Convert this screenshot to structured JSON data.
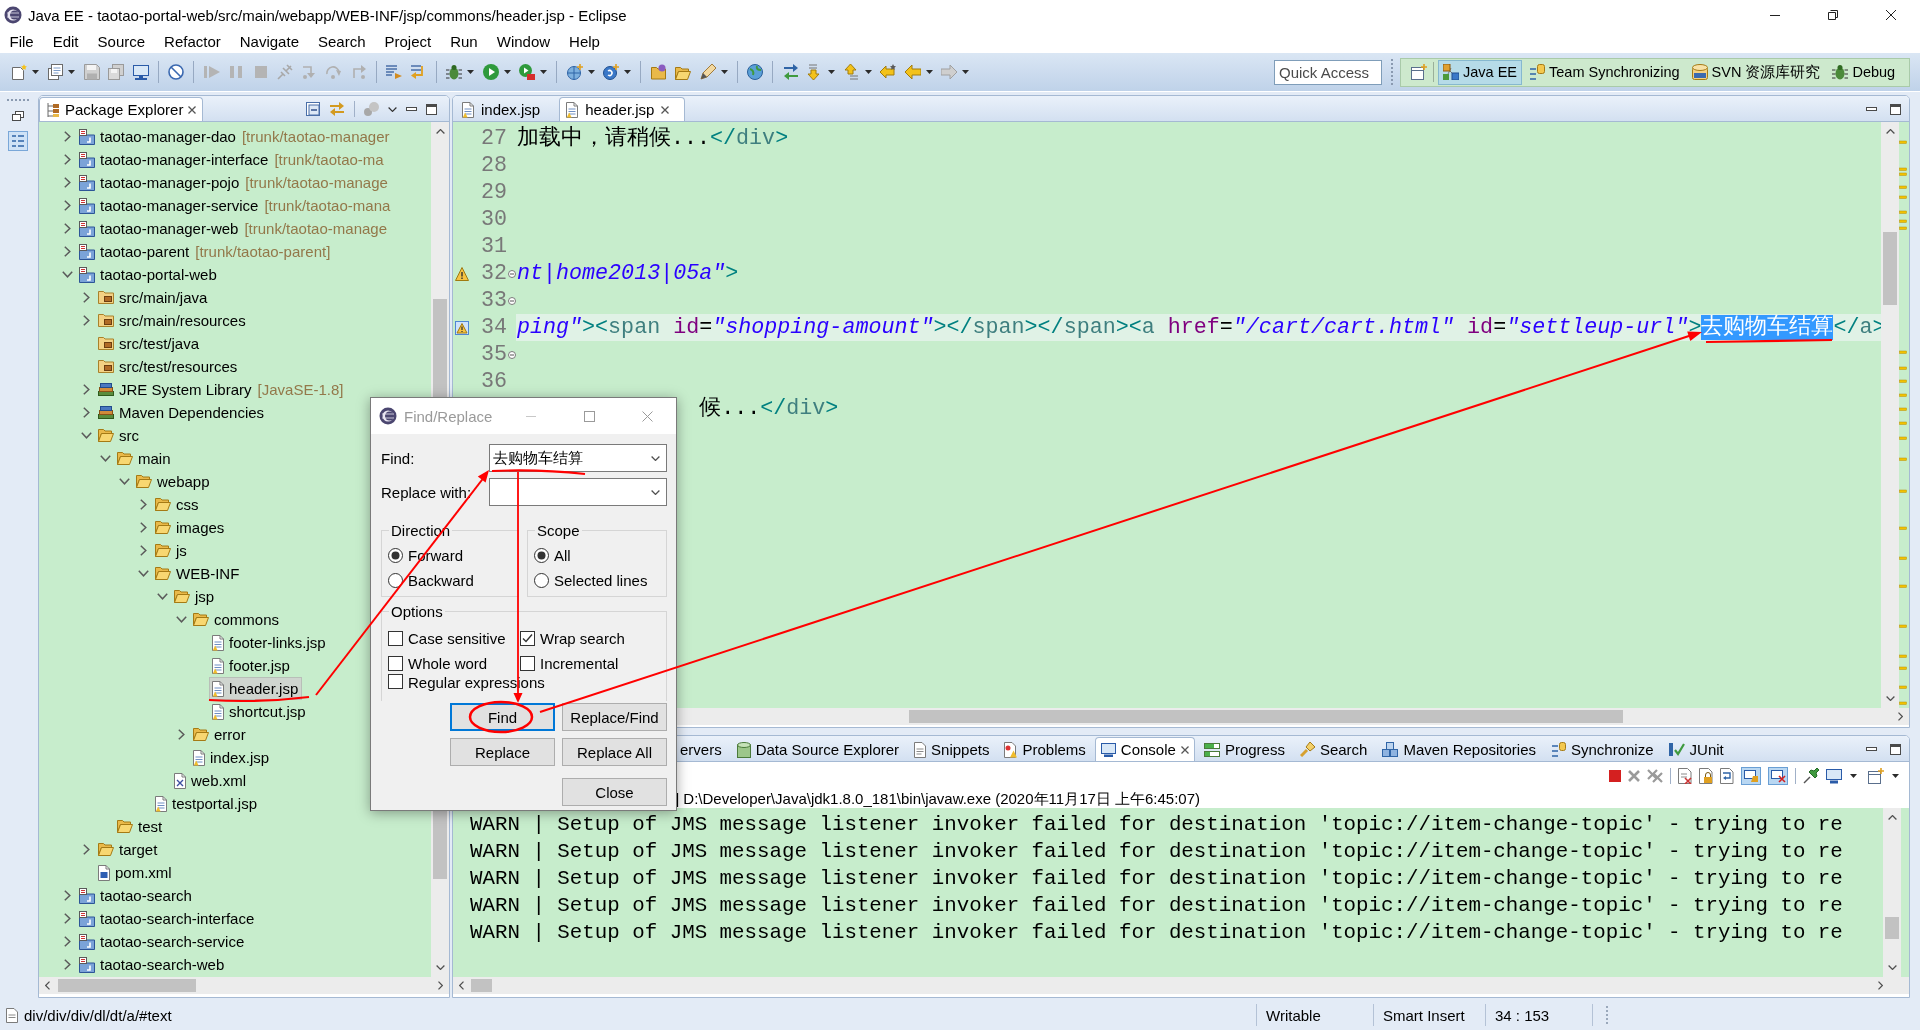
{
  "window": {
    "title": "Java EE - taotao-portal-web/src/main/webapp/WEB-INF/jsp/commons/header.jsp - Eclipse"
  },
  "menu": [
    "File",
    "Edit",
    "Source",
    "Refactor",
    "Navigate",
    "Search",
    "Project",
    "Run",
    "Window",
    "Help"
  ],
  "quick_access": {
    "placeholder": "Quick Access"
  },
  "perspectives": [
    {
      "label": "Java EE",
      "selected": true
    },
    {
      "label": "Team Synchronizing",
      "selected": false
    },
    {
      "label": "SVN 资源库研究",
      "selected": false
    },
    {
      "label": "Debug",
      "selected": false
    }
  ],
  "package_explorer": {
    "tab": "Package Explorer",
    "tree": [
      {
        "label": "taotao-manager-dao",
        "decoration": "[trunk/taotao-manager",
        "kind": "project",
        "expanded": false,
        "selected": false
      },
      {
        "label": "taotao-manager-interface",
        "decoration": "[trunk/taotao-ma",
        "kind": "project",
        "expanded": false,
        "selected": false
      },
      {
        "label": "taotao-manager-pojo",
        "decoration": "[trunk/taotao-manage",
        "kind": "project",
        "expanded": false,
        "selected": false
      },
      {
        "label": "taotao-manager-service",
        "decoration": "[trunk/taotao-mana",
        "kind": "project",
        "expanded": false,
        "selected": false
      },
      {
        "label": "taotao-manager-web",
        "decoration": "[trunk/taotao-manage",
        "kind": "project",
        "expanded": false,
        "selected": false
      },
      {
        "label": "taotao-parent",
        "decoration": "[trunk/taotao-parent]",
        "kind": "project",
        "expanded": false,
        "selected": false
      },
      {
        "label": "taotao-portal-web",
        "kind": "project",
        "expanded": true,
        "selected": false,
        "children": [
          {
            "label": "src/main/java",
            "kind": "source-folder",
            "expanded": false,
            "selected": false
          },
          {
            "label": "src/main/resources",
            "kind": "source-folder",
            "expanded": false,
            "selected": false
          },
          {
            "label": "src/test/java",
            "kind": "source-folder",
            "selected": false
          },
          {
            "label": "src/test/resources",
            "kind": "source-folder",
            "selected": false
          },
          {
            "label": "JRE System Library",
            "decoration": "[JavaSE-1.8]",
            "kind": "library",
            "expanded": false,
            "selected": false
          },
          {
            "label": "Maven Dependencies",
            "kind": "library",
            "expanded": false,
            "selected": false
          },
          {
            "label": "src",
            "kind": "folder",
            "expanded": true,
            "selected": false,
            "children": [
              {
                "label": "main",
                "kind": "folder",
                "expanded": true,
                "selected": false,
                "children": [
                  {
                    "label": "webapp",
                    "kind": "folder",
                    "expanded": true,
                    "selected": false,
                    "children": [
                      {
                        "label": "css",
                        "kind": "folder",
                        "expanded": false,
                        "selected": false
                      },
                      {
                        "label": "images",
                        "kind": "folder",
                        "expanded": false,
                        "selected": false
                      },
                      {
                        "label": "js",
                        "kind": "folder",
                        "expanded": false,
                        "selected": false
                      },
                      {
                        "label": "WEB-INF",
                        "kind": "folder",
                        "expanded": true,
                        "selected": false,
                        "children": [
                          {
                            "label": "jsp",
                            "kind": "folder",
                            "expanded": true,
                            "selected": false,
                            "children": [
                              {
                                "label": "commons",
                                "kind": "folder",
                                "expanded": true,
                                "selected": false,
                                "children": [
                                  {
                                    "label": "footer-links.jsp",
                                    "kind": "jsp",
                                    "selected": false
                                  },
                                  {
                                    "label": "footer.jsp",
                                    "kind": "jsp",
                                    "selected": false
                                  },
                                  {
                                    "label": "header.jsp",
                                    "kind": "jsp",
                                    "selected": true
                                  },
                                  {
                                    "label": "shortcut.jsp",
                                    "kind": "jsp",
                                    "selected": false
                                  }
                                ]
                              },
                              {
                                "label": "error",
                                "kind": "folder",
                                "expanded": false,
                                "selected": false
                              },
                              {
                                "label": "index.jsp",
                                "kind": "jsp",
                                "selected": false
                              }
                            ]
                          },
                          {
                            "label": "web.xml",
                            "kind": "xml",
                            "selected": false
                          }
                        ]
                      },
                      {
                        "label": "testportal.jsp",
                        "kind": "jsp",
                        "selected": false
                      }
                    ]
                  }
                ]
              },
              {
                "label": "test",
                "kind": "folder",
                "selected": false
              }
            ]
          },
          {
            "label": "target",
            "kind": "folder",
            "expanded": false,
            "selected": false
          },
          {
            "label": "pom.xml",
            "kind": "pom",
            "selected": false
          }
        ]
      },
      {
        "label": "taotao-search",
        "kind": "project",
        "expanded": false,
        "selected": false
      },
      {
        "label": "taotao-search-interface",
        "kind": "project",
        "expanded": false,
        "selected": false
      },
      {
        "label": "taotao-search-service",
        "kind": "project",
        "expanded": false,
        "selected": false
      },
      {
        "label": "taotao-search-web",
        "kind": "project",
        "expanded": false,
        "selected": false
      }
    ]
  },
  "editor": {
    "tabs": [
      {
        "label": "index.jsp",
        "selected": false
      },
      {
        "label": "header.jsp",
        "selected": true
      }
    ],
    "lines": [
      {
        "number": "27",
        "warning": false,
        "fold": false,
        "current": false,
        "segments": [
          {
            "kind": "text",
            "text": "加载中，请稍候..."
          },
          {
            "kind": "bracket",
            "text": "</"
          },
          {
            "kind": "tag",
            "text": "div"
          },
          {
            "kind": "bracket",
            "text": ">"
          }
        ]
      },
      {
        "number": "28",
        "warning": false,
        "fold": false,
        "current": false
      },
      {
        "number": "29",
        "warning": false,
        "fold": false,
        "current": false
      },
      {
        "number": "30",
        "warning": false,
        "fold": false,
        "current": false
      },
      {
        "number": "31",
        "warning": false,
        "fold": false,
        "current": false
      },
      {
        "number": "32",
        "warning": true,
        "fold": true,
        "current": false,
        "segments": [
          {
            "kind": "value",
            "text": "nt|home2013|05a\""
          },
          {
            "kind": "bracket",
            "text": ">"
          }
        ]
      },
      {
        "number": "33",
        "warning": false,
        "fold": true,
        "current": false
      },
      {
        "number": "34",
        "warning": true,
        "fold": false,
        "current": true,
        "segments": [
          {
            "kind": "value",
            "text": "ping\""
          },
          {
            "kind": "bracket",
            "text": "><"
          },
          {
            "kind": "tag",
            "text": "span"
          },
          {
            "kind": "attr",
            "text": " id"
          },
          {
            "kind": "plain",
            "text": "="
          },
          {
            "kind": "value",
            "text": "\"shopping-amount\""
          },
          {
            "kind": "bracket",
            "text": "></"
          },
          {
            "kind": "tag",
            "text": "span"
          },
          {
            "kind": "bracket",
            "text": "></"
          },
          {
            "kind": "tag",
            "text": "span"
          },
          {
            "kind": "bracket",
            "text": "><"
          },
          {
            "kind": "tag",
            "text": "a"
          },
          {
            "kind": "attr",
            "text": " href"
          },
          {
            "kind": "plain",
            "text": "="
          },
          {
            "kind": "value",
            "text": "\"/cart/cart.html\""
          },
          {
            "kind": "attr",
            "text": " id"
          },
          {
            "kind": "plain",
            "text": "="
          },
          {
            "kind": "value",
            "text": "\"settleup-url\""
          },
          {
            "kind": "bracket",
            "text": ">"
          },
          {
            "kind": "selection",
            "text": "去购物车结算"
          },
          {
            "kind": "bracket",
            "text": "</"
          },
          {
            "kind": "tag",
            "text": "a"
          },
          {
            "kind": "bracket",
            "text": ">"
          }
        ]
      },
      {
        "number": "35",
        "warning": false,
        "fold": true,
        "current": false
      },
      {
        "number": "36",
        "warning": false,
        "fold": false,
        "current": false
      },
      {
        "warning": false,
        "fold": false,
        "current": false,
        "segments": [
          {
            "kind": "text",
            "text": "              候..."
          },
          {
            "kind": "bracket",
            "text": "</"
          },
          {
            "kind": "tag",
            "text": "div"
          },
          {
            "kind": "bracket",
            "text": ">"
          }
        ]
      }
    ]
  },
  "find_dialog": {
    "title": "Find/Replace",
    "find": {
      "label": "Find:",
      "value": "去购物车结算"
    },
    "replace": {
      "label": "Replace with:"
    },
    "direction": {
      "title": "Direction",
      "options": [
        {
          "label": "Forward",
          "selected": true
        },
        {
          "label": "Backward",
          "selected": false
        }
      ]
    },
    "scope": {
      "title": "Scope",
      "options": [
        {
          "label": "All",
          "selected": true
        },
        {
          "label": "Selected lines",
          "selected": false
        }
      ]
    },
    "options": {
      "title": "Options",
      "items": [
        {
          "label": "Case sensitive",
          "checked": false
        },
        {
          "label": "Wrap search",
          "checked": true
        },
        {
          "label": "Whole word",
          "checked": false
        },
        {
          "label": "Incremental",
          "checked": false
        },
        {
          "label": "Regular expressions",
          "checked": false
        }
      ]
    },
    "buttons": [
      {
        "label": "Find",
        "focused": true
      },
      {
        "label": "Replace/Find",
        "focused": false
      },
      {
        "label": "Replace",
        "focused": false
      },
      {
        "label": "Replace All",
        "focused": false
      },
      {
        "label": "Close",
        "focused": false
      }
    ]
  },
  "bottom_panel": {
    "tabs": [
      {
        "label": "ervers",
        "selected": false
      },
      {
        "label": "Data Source Explorer",
        "selected": false
      },
      {
        "label": "Snippets",
        "selected": false
      },
      {
        "label": "Problems",
        "selected": false
      },
      {
        "label": "Console",
        "selected": true
      },
      {
        "label": "Progress",
        "selected": false
      },
      {
        "label": "Search",
        "selected": false
      },
      {
        "label": "Maven Repositories",
        "selected": false
      },
      {
        "label": "Synchronize",
        "selected": false
      },
      {
        "label": "JUnit",
        "selected": false
      }
    ],
    "console_header": "] D:\\Developer\\Java\\jdk1.8.0_181\\bin\\javaw.exe (2020年11月17日 上午6:45:07)",
    "console_lines": [
      "WARN | Setup of JMS message listener invoker failed for destination 'topic://item-change-topic' - trying to re",
      "WARN | Setup of JMS message listener invoker failed for destination 'topic://item-change-topic' - trying to re",
      "WARN | Setup of JMS message listener invoker failed for destination 'topic://item-change-topic' - trying to re",
      "WARN | Setup of JMS message listener invoker failed for destination 'topic://item-change-topic' - trying to re",
      "WARN | Setup of JMS message listener invoker failed for destination 'topic://item-change-topic' - trying to re"
    ]
  },
  "status_bar": {
    "path": "div/div/div/dl/dt/a/#text",
    "mode": "Writable",
    "insert_mode": "Smart Insert",
    "position": "34 : 153"
  }
}
